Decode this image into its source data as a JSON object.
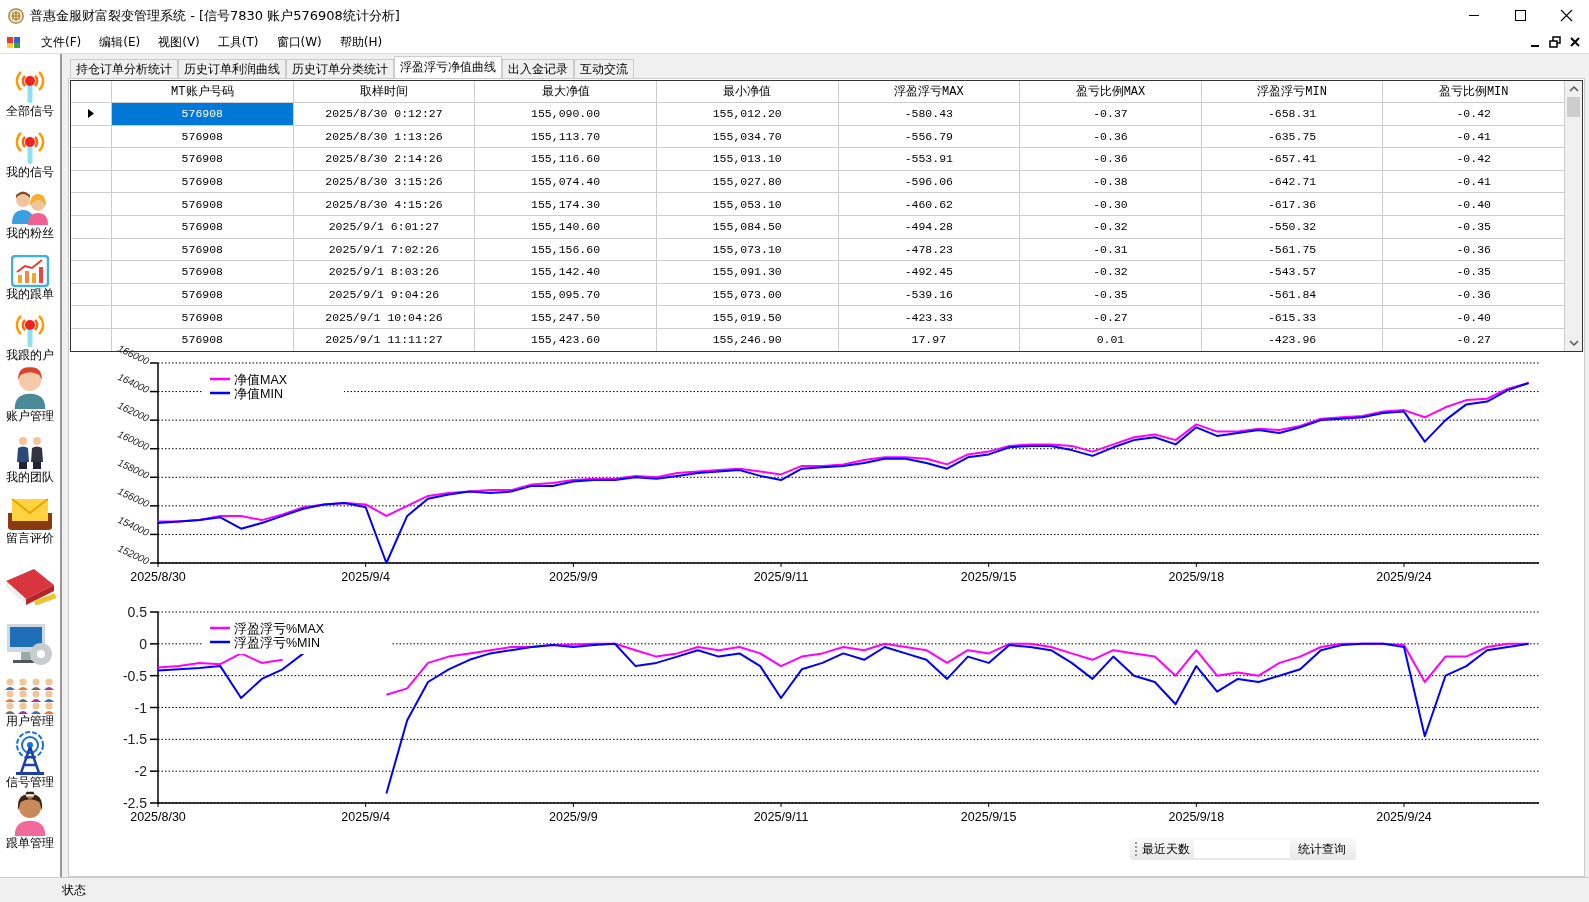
{
  "window": {
    "title": "普惠金服财富裂变管理系统 - [信号7830 账户576908统计分析]"
  },
  "menu": [
    "文件(F)",
    "编辑(E)",
    "视图(V)",
    "工具(T)",
    "窗口(W)",
    "帮助(H)"
  ],
  "sidebar": {
    "items": [
      {
        "kind": "signal",
        "label": "全部信号"
      },
      {
        "kind": "signal",
        "label": "我的信号"
      },
      {
        "kind": "fans",
        "label": "我的粉丝"
      },
      {
        "kind": "chart",
        "label": "我的跟单"
      },
      {
        "kind": "signal",
        "label": "我跟的户"
      },
      {
        "kind": "person",
        "label": "账户管理"
      },
      {
        "kind": "team",
        "label": "我的团队"
      },
      {
        "kind": "mail",
        "label": "留言评价"
      },
      {
        "kind": "book"
      },
      {
        "kind": "computer"
      },
      {
        "kind": "users",
        "label": "用户管理"
      },
      {
        "kind": "tower",
        "label": "信号管理"
      },
      {
        "kind": "woman",
        "label": "跟单管理"
      }
    ]
  },
  "tabs": [
    {
      "label": "持仓订单分析统计",
      "selected": false
    },
    {
      "label": "历史订单利润曲线",
      "selected": false
    },
    {
      "label": "历史订单分类统计",
      "selected": false
    },
    {
      "label": "浮盈浮亏净值曲线",
      "selected": true
    },
    {
      "label": "出入金记录",
      "selected": false
    },
    {
      "label": "互动交流",
      "selected": false
    }
  ],
  "table": {
    "columns": [
      "MT账户号码",
      "取样时间",
      "最大净值",
      "最小净值",
      "浮盈浮亏MAX",
      "盈亏比例MAX",
      "浮盈浮亏MIN",
      "盈亏比例MIN"
    ],
    "rows": [
      {
        "selected": true,
        "cells": [
          "576908",
          "2025/8/30 0:12:27",
          "155,090.00",
          "155,012.20",
          "-580.43",
          "-0.37",
          "-658.31",
          "-0.42"
        ]
      },
      {
        "selected": false,
        "cells": [
          "576908",
          "2025/8/30 1:13:26",
          "155,113.70",
          "155,034.70",
          "-556.79",
          "-0.36",
          "-635.75",
          "-0.41"
        ]
      },
      {
        "selected": false,
        "cells": [
          "576908",
          "2025/8/30 2:14:26",
          "155,116.60",
          "155,013.10",
          "-553.91",
          "-0.36",
          "-657.41",
          "-0.42"
        ]
      },
      {
        "selected": false,
        "cells": [
          "576908",
          "2025/8/30 3:15:26",
          "155,074.40",
          "155,027.80",
          "-596.06",
          "-0.38",
          "-642.71",
          "-0.41"
        ]
      },
      {
        "selected": false,
        "cells": [
          "576908",
          "2025/8/30 4:15:26",
          "155,174.30",
          "155,053.10",
          "-460.62",
          "-0.30",
          "-617.36",
          "-0.40"
        ]
      },
      {
        "selected": false,
        "cells": [
          "576908",
          "2025/9/1 6:01:27",
          "155,140.60",
          "155,084.50",
          "-494.28",
          "-0.32",
          "-550.32",
          "-0.35"
        ]
      },
      {
        "selected": false,
        "cells": [
          "576908",
          "2025/9/1 7:02:26",
          "155,156.60",
          "155,073.10",
          "-478.23",
          "-0.31",
          "-561.75",
          "-0.36"
        ]
      },
      {
        "selected": false,
        "cells": [
          "576908",
          "2025/9/1 8:03:26",
          "155,142.40",
          "155,091.30",
          "-492.45",
          "-0.32",
          "-543.57",
          "-0.35"
        ]
      },
      {
        "selected": false,
        "cells": [
          "576908",
          "2025/9/1 9:04:26",
          "155,095.70",
          "155,073.00",
          "-539.16",
          "-0.35",
          "-561.84",
          "-0.36"
        ]
      },
      {
        "selected": false,
        "cells": [
          "576908",
          "2025/9/1 10:04:26",
          "155,247.50",
          "155,019.50",
          "-423.33",
          "-0.27",
          "-615.33",
          "-0.40"
        ]
      },
      {
        "selected": false,
        "cells": [
          "576908",
          "2025/9/1 11:11:27",
          "155,423.60",
          "155,246.90",
          "17.97",
          "0.01",
          "-423.96",
          "-0.27"
        ]
      }
    ]
  },
  "charts": [
    {
      "chart_data": {
        "type": "line",
        "grid": true,
        "legend": "upper left",
        "ylim": [
          152000,
          166000
        ],
        "yticks": [
          152000,
          154000,
          156000,
          158000,
          160000,
          162000,
          164000,
          166000
        ],
        "categories": [
          "2025/8/30",
          null,
          null,
          null,
          null,
          null,
          null,
          null,
          null,
          null,
          "2025/9/4",
          null,
          null,
          null,
          null,
          null,
          null,
          null,
          null,
          null,
          "2025/9/9",
          null,
          null,
          null,
          null,
          null,
          null,
          null,
          null,
          null,
          "2025/9/11",
          null,
          null,
          null,
          null,
          null,
          null,
          null,
          null,
          null,
          "2025/9/15",
          null,
          null,
          null,
          null,
          null,
          null,
          null,
          null,
          null,
          "2025/9/18",
          null,
          null,
          null,
          null,
          null,
          null,
          null,
          null,
          null,
          "2025/9/24",
          null,
          null,
          null,
          null,
          null,
          null
        ],
        "series": [
          {
            "name": "净值MAX",
            "color": "#ff00ff",
            "values": [
              154900,
              154900,
              155000,
              155300,
              155300,
              155000,
              155400,
              155900,
              156100,
              156200,
              156100,
              155300,
              156000,
              156700,
              156900,
              157000,
              157100,
              157100,
              157500,
              157600,
              157800,
              157900,
              157900,
              158100,
              158000,
              158300,
              158400,
              158500,
              158600,
              158400,
              158200,
              158800,
              158800,
              158900,
              159200,
              159400,
              159400,
              159300,
              158900,
              159600,
              159800,
              160200,
              160300,
              160300,
              160200,
              159800,
              160300,
              160800,
              161000,
              160600,
              161700,
              161200,
              161200,
              161400,
              161300,
              161600,
              162100,
              162200,
              162300,
              162600,
              162700,
              162200,
              162900,
              163400,
              163500,
              164200,
              164600
            ]
          },
          {
            "name": "净值MIN",
            "color": "#0000ff",
            "values": [
              154800,
              154900,
              155000,
              155200,
              154400,
              154800,
              155300,
              155800,
              156100,
              156200,
              155900,
              152000,
              155300,
              156500,
              156800,
              157000,
              156900,
              157000,
              157400,
              157400,
              157700,
              157800,
              157800,
              158000,
              157900,
              158100,
              158300,
              158400,
              158500,
              158100,
              157800,
              158600,
              158700,
              158800,
              159000,
              159300,
              159300,
              159000,
              158600,
              159400,
              159600,
              160100,
              160200,
              160200,
              159900,
              159500,
              160100,
              160600,
              160800,
              160300,
              161500,
              160900,
              161100,
              161300,
              161100,
              161500,
              162000,
              162100,
              162200,
              162500,
              162600,
              160500,
              162000,
              163100,
              163300,
              164100,
              164600
            ]
          }
        ]
      }
    },
    {
      "chart_data": {
        "type": "line",
        "grid": true,
        "legend": "upper left",
        "ylim": [
          -2.5,
          0.5
        ],
        "yticks": [
          -2.5,
          -2,
          -1.5,
          -1,
          -0.5,
          0,
          0.5
        ],
        "categories": [
          "2025/8/30",
          null,
          null,
          null,
          null,
          null,
          null,
          null,
          null,
          null,
          "2025/9/4",
          null,
          null,
          null,
          null,
          null,
          null,
          null,
          null,
          null,
          "2025/9/9",
          null,
          null,
          null,
          null,
          null,
          null,
          null,
          null,
          null,
          "2025/9/11",
          null,
          null,
          null,
          null,
          null,
          null,
          null,
          null,
          null,
          "2025/9/15",
          null,
          null,
          null,
          null,
          null,
          null,
          null,
          null,
          null,
          "2025/9/18",
          null,
          null,
          null,
          null,
          null,
          null,
          null,
          null,
          null,
          "2025/9/24",
          null,
          null,
          null,
          null,
          null,
          null
        ],
        "series": [
          {
            "name": "浮盈浮亏%MAX",
            "color": "#ff00ff",
            "values": [
              -0.37,
              -0.35,
              -0.3,
              -0.32,
              -0.15,
              -0.3,
              -0.25,
              null,
              null,
              null,
              null,
              -0.8,
              -0.7,
              -0.3,
              -0.2,
              -0.15,
              -0.1,
              -0.05,
              -0.05,
              -0.02,
              -0.01,
              0,
              0,
              -0.1,
              -0.2,
              -0.15,
              -0.05,
              -0.1,
              -0.05,
              -0.15,
              -0.35,
              -0.2,
              -0.15,
              -0.05,
              -0.1,
              0,
              -0.05,
              -0.1,
              -0.3,
              -0.1,
              -0.15,
              0,
              0,
              -0.05,
              -0.15,
              -0.25,
              -0.1,
              -0.15,
              -0.2,
              -0.5,
              -0.1,
              -0.5,
              -0.45,
              -0.5,
              -0.3,
              -0.2,
              -0.05,
              0,
              0,
              0,
              -0.02,
              -0.6,
              -0.2,
              -0.2,
              -0.05,
              0,
              0
            ]
          },
          {
            "name": "浮盈浮亏%MIN",
            "color": "#0000ff",
            "values": [
              -0.42,
              -0.4,
              -0.38,
              -0.35,
              -0.85,
              -0.55,
              -0.4,
              -0.15,
              null,
              null,
              null,
              -2.35,
              -1.2,
              -0.6,
              -0.4,
              -0.25,
              -0.15,
              -0.1,
              -0.05,
              -0.02,
              -0.05,
              -0.02,
              0,
              -0.35,
              -0.3,
              -0.2,
              -0.1,
              -0.2,
              -0.15,
              -0.35,
              -0.85,
              -0.4,
              -0.3,
              -0.15,
              -0.25,
              -0.05,
              -0.15,
              -0.25,
              -0.55,
              -0.2,
              -0.3,
              -0.02,
              -0.05,
              -0.1,
              -0.3,
              -0.55,
              -0.2,
              -0.5,
              -0.6,
              -0.95,
              -0.35,
              -0.75,
              -0.55,
              -0.6,
              -0.5,
              -0.4,
              -0.1,
              -0.02,
              0,
              0,
              -0.05,
              -1.45,
              -0.5,
              -0.35,
              -0.1,
              -0.05,
              0
            ]
          }
        ]
      }
    }
  ],
  "toolbar": {
    "days_label": "最近天数",
    "query_button": "统计查询"
  },
  "status_bar": "状态"
}
